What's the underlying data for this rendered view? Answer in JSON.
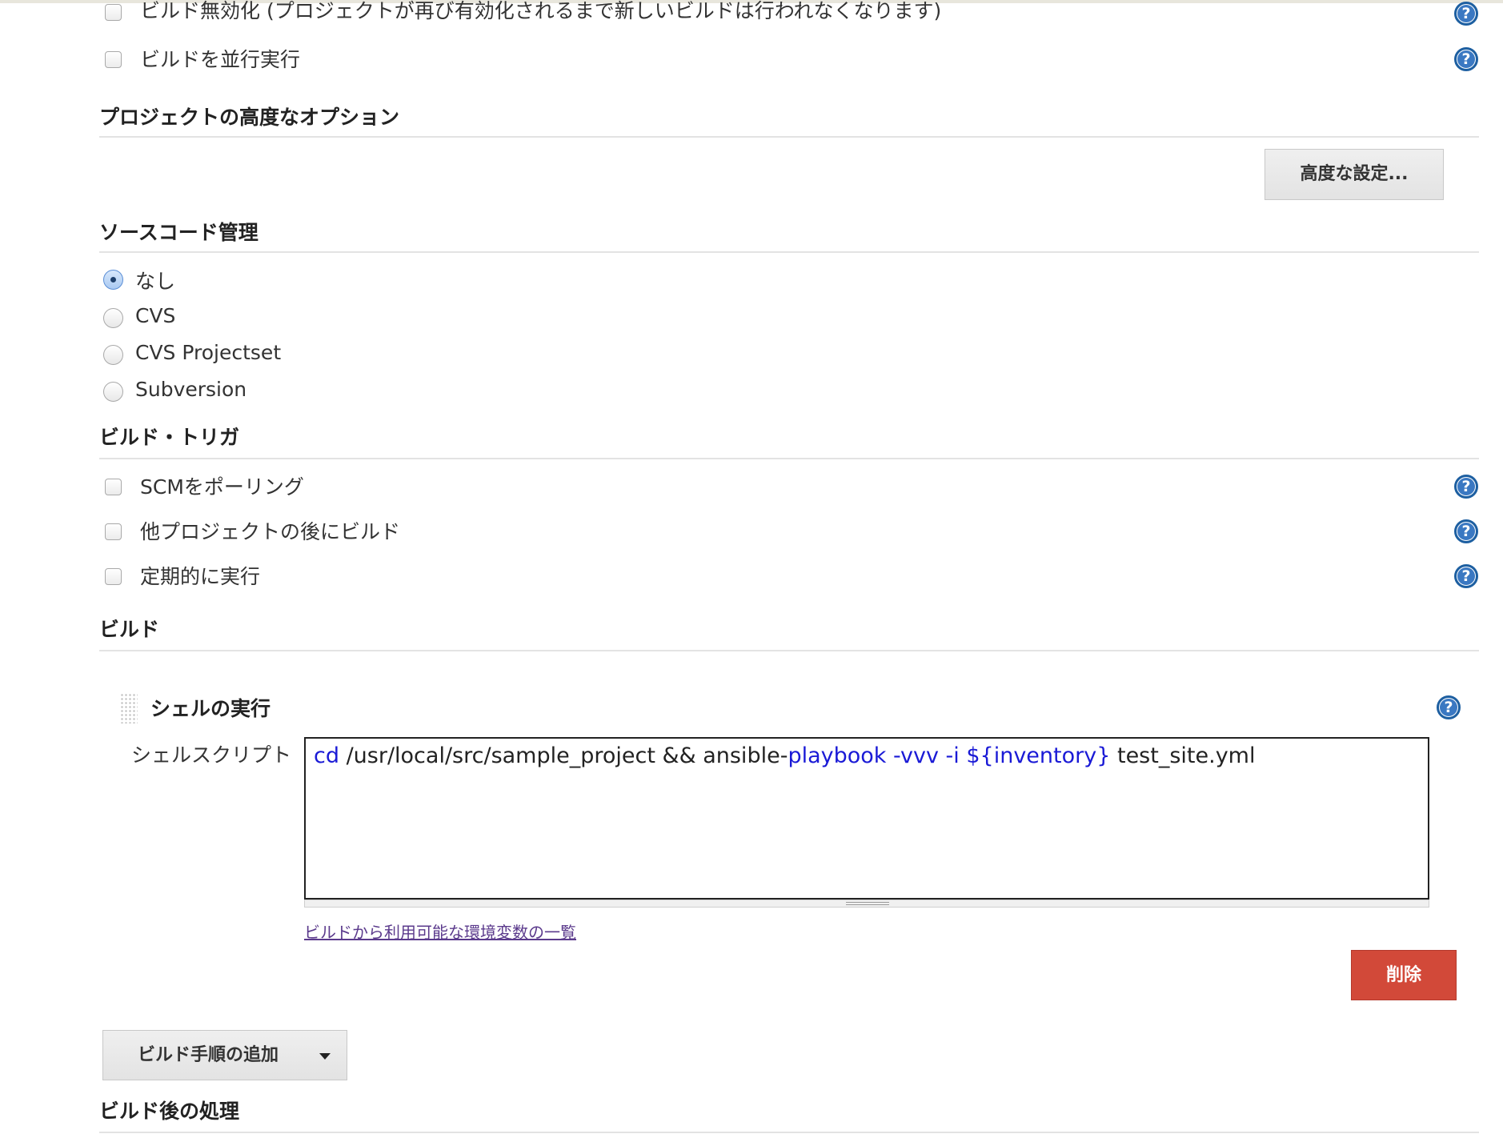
{
  "general_options": {
    "disable_build": "ビルド無効化 (プロジェクトが再び有効化されるまで新しいビルドは行われなくなります)",
    "concurrent_build": "ビルドを並行実行"
  },
  "advanced_project": {
    "title": "プロジェクトの高度なオプション",
    "advanced_button": "高度な設定..."
  },
  "scm": {
    "title": "ソースコード管理",
    "options": [
      {
        "label": "なし",
        "selected": true
      },
      {
        "label": "CVS",
        "selected": false
      },
      {
        "label": "CVS Projectset",
        "selected": false
      },
      {
        "label": "Subversion",
        "selected": false
      }
    ]
  },
  "triggers": {
    "title": "ビルド・トリガ",
    "items": [
      "SCMをポーリング",
      "他プロジェクトの後にビルド",
      "定期的に実行"
    ]
  },
  "build": {
    "title": "ビルド",
    "step_title": "シェルの実行",
    "script_label": "シェルスクリプト",
    "script_tokens": {
      "t1": "cd",
      "t2": " /usr/local/src/sample_project && ansible-",
      "t3": "playbook -vvv -i ${inventory}",
      "t4": " test_site.yml"
    },
    "env_link": "ビルドから利用可能な環境変数の一覧",
    "delete_button": "削除",
    "add_step_button": "ビルド手順の追加"
  },
  "post_build": {
    "title": "ビルド後の処理"
  },
  "help_icon_glyph": "?",
  "colors": {
    "delete_red": "#d24939",
    "link_purple": "#5b3a8c",
    "keyword_blue": "#1a1ad6"
  }
}
